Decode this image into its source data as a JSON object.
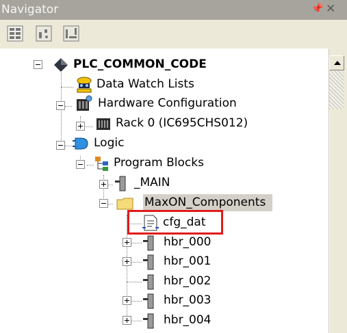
{
  "panel": {
    "title": "Navigator",
    "pin_glyph": "╀",
    "close_glyph": "✕"
  },
  "toolbar": {
    "buttons": [
      {
        "icon": "project-view-icon"
      },
      {
        "icon": "variables-view-icon"
      },
      {
        "icon": "toolchest-view-icon"
      }
    ]
  },
  "tree": {
    "root": "PLC_COMMON_CODE",
    "data_watch": "Data Watch Lists",
    "hardware": "Hardware Configuration",
    "rack": "Rack 0 (IC695CHS012)",
    "logic": "Logic",
    "program_blocks": "Program Blocks",
    "main": "_MAIN",
    "maxon": "MaxON_Components",
    "cfg": "cfg_dat",
    "hbr000": "hbr_000",
    "hbr001": "hbr_001",
    "hbr002": "hbr_002",
    "hbr003": "hbr_003",
    "hbr004": "hbr_004"
  },
  "colors": {
    "title_bg": "#a6a49c",
    "toolbar_bg": "#ece9d8",
    "highlight_border": "#e01b1b",
    "selected_bg": "#d4d0c8"
  }
}
